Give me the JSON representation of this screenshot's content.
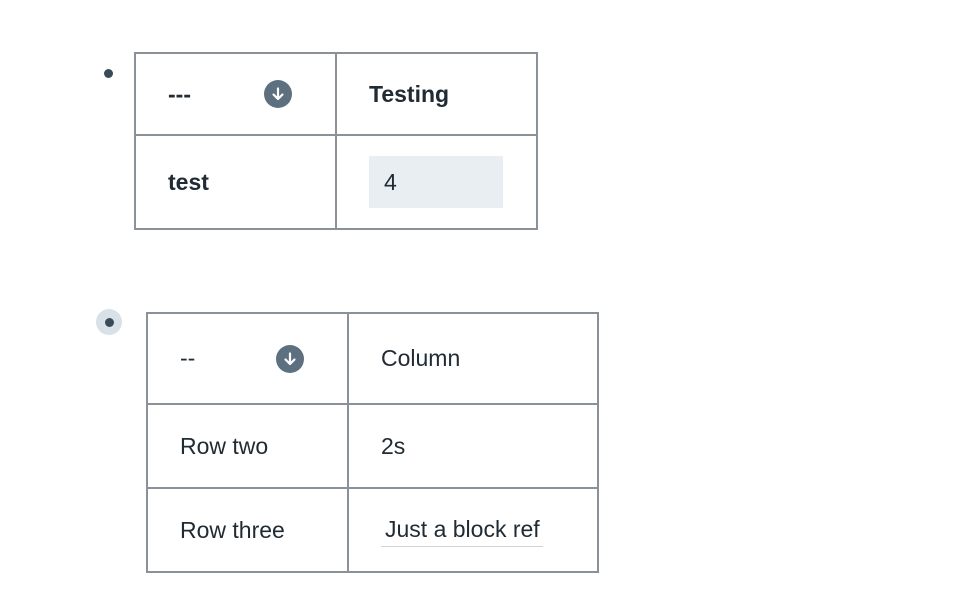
{
  "blocks": [
    {
      "header": {
        "key_label": "---",
        "column_label": "Testing"
      },
      "row": {
        "label": "test",
        "value": "4"
      }
    },
    {
      "header": {
        "key_label": "--",
        "column_label": "Column"
      },
      "rows": [
        {
          "label": "Row two",
          "value": "2s"
        },
        {
          "label": "Row three",
          "value": "Just a block ref"
        }
      ]
    }
  ],
  "icons": {
    "column_menu": "arrow-down-circle-icon",
    "bullet": "bullet-dot-icon"
  },
  "colors": {
    "text": "#202b33",
    "border": "#8a9199",
    "icon_bg": "#5c7080",
    "input_bg": "#e9eef2",
    "bullet_halo": "#d8e1e8"
  }
}
